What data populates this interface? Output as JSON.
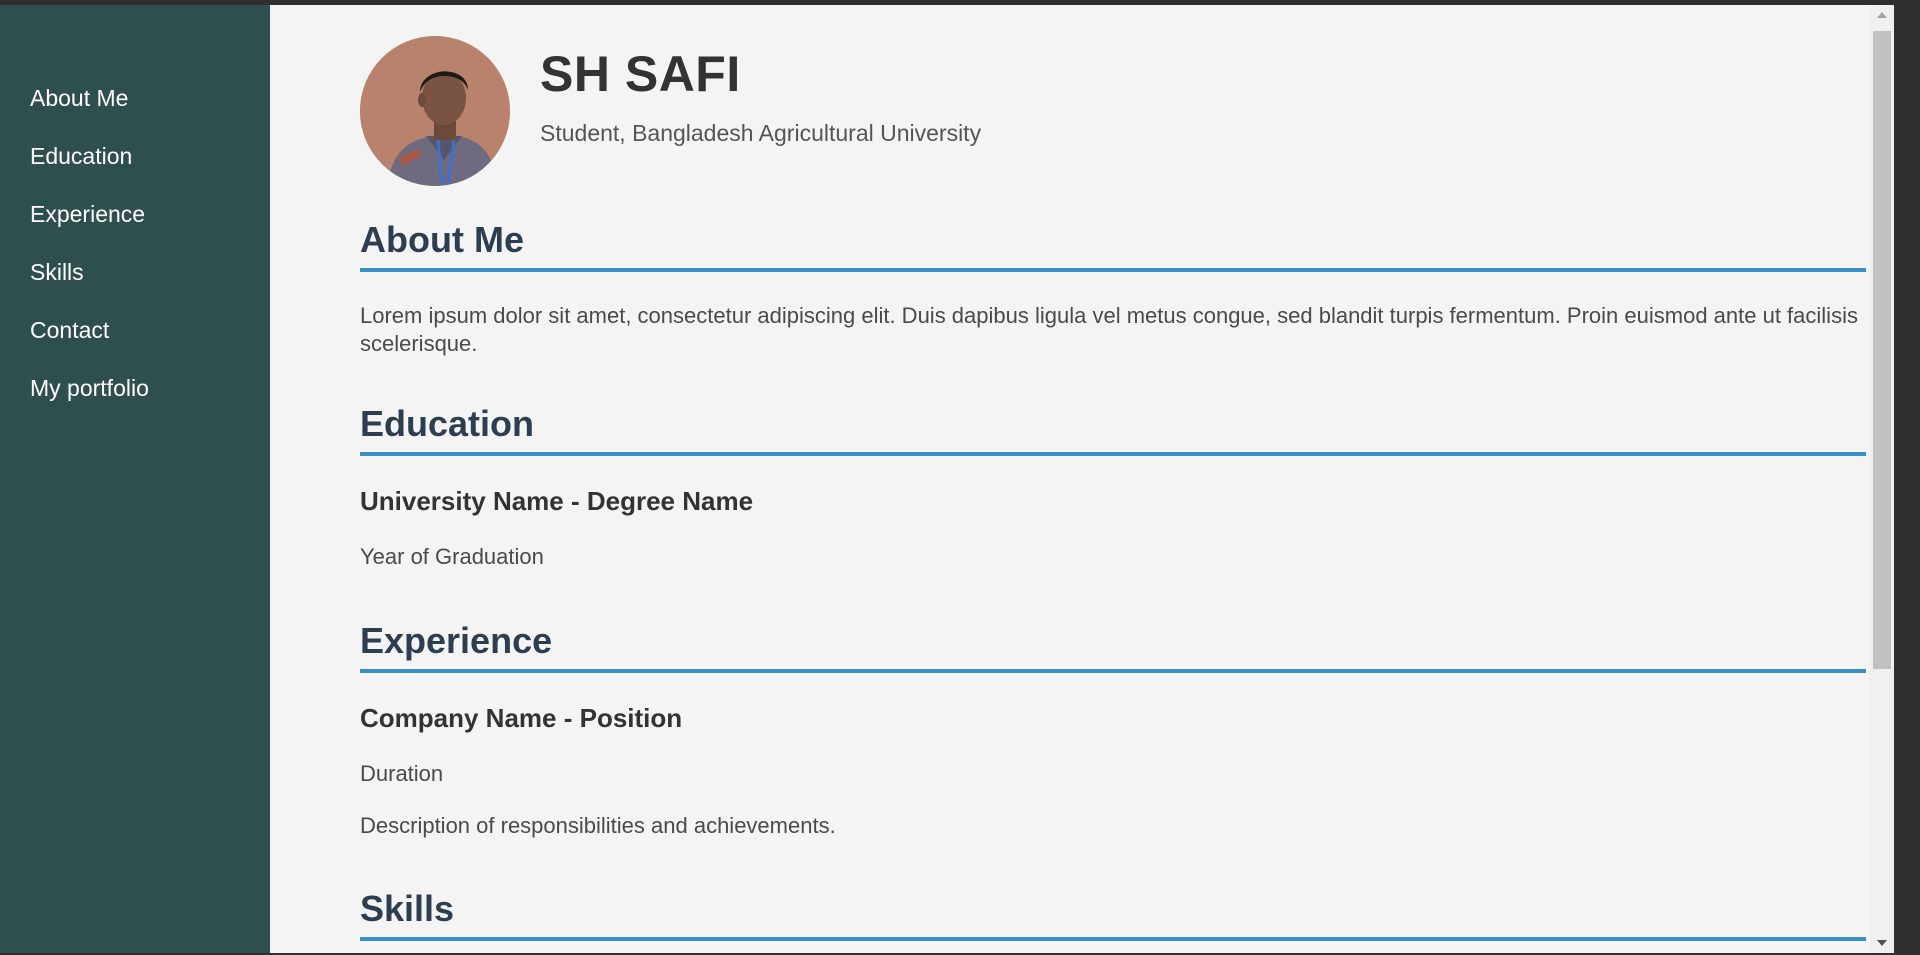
{
  "nav": {
    "items": [
      {
        "label": "About Me"
      },
      {
        "label": "Education"
      },
      {
        "label": "Experience"
      },
      {
        "label": "Skills"
      },
      {
        "label": "Contact"
      },
      {
        "label": "My portfolio"
      }
    ]
  },
  "profile": {
    "name": "SH SAFI",
    "subtitle": "Student, Bangladesh Agricultural University"
  },
  "about": {
    "title": "About Me",
    "text": "Lorem ipsum dolor sit amet, consectetur adipiscing elit. Duis dapibus ligula vel metus congue, sed blandit turpis fermentum. Proin euismod ante ut facilisis scelerisque."
  },
  "education": {
    "title": "Education",
    "entry_title": "University Name - Degree Name",
    "entry_year": "Year of Graduation"
  },
  "experience": {
    "title": "Experience",
    "entry_title": "Company Name - Position",
    "entry_duration": "Duration",
    "entry_description": "Description of responsibilities and achievements."
  },
  "skills": {
    "title": "Skills"
  },
  "colors": {
    "sidebar_bg": "#2f4f4f",
    "main_bg": "#f4f4f4",
    "heading": "#2c3e50",
    "accent_rule": "#3a8fc8"
  }
}
